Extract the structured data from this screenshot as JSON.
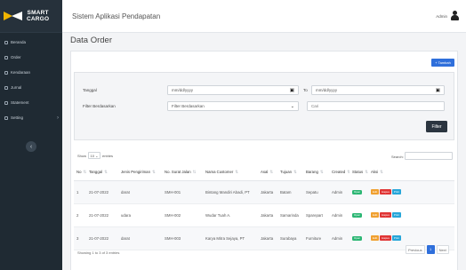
{
  "brand": {
    "line1": "SMART",
    "line2": "CARGO"
  },
  "app_title": "Sistem Aplikasi Pendapatan",
  "user": {
    "name": "Admin"
  },
  "sidebar": {
    "items": [
      {
        "label": "Beranda"
      },
      {
        "label": "Order"
      },
      {
        "label": "Kendaraan"
      },
      {
        "label": "Jurnal"
      },
      {
        "label": "Statement"
      },
      {
        "label": "Setting"
      }
    ],
    "toggle_icon": "‹"
  },
  "page_title": "Data Order",
  "buttons": {
    "tambah": "+ Tambah",
    "filter": "Filter"
  },
  "filter": {
    "tanggal_label": "Tanggal",
    "date_from": "mm/dd/yyyy",
    "to_label": "To",
    "date_to": "mm/dd/yyyy",
    "berdasarkan_label": "Filter Berdasarkan",
    "select_value": "Filter Berdasarkan",
    "cari_placeholder": "Cari"
  },
  "table_controls": {
    "show_label": "Show",
    "entries_value": "10",
    "entries_label": "entries",
    "search_label": "Search:"
  },
  "table": {
    "headers": [
      "No",
      "Tanggal",
      "Jenis Pengiriman",
      "No. Surat Jalan",
      "Nama Customer",
      "Asal",
      "Tujuan",
      "Barang",
      "Created",
      "Status",
      "Aksi"
    ],
    "rows": [
      [
        "1",
        "21-07-2022",
        "darat",
        "SMH-001",
        "Bintang Mandiri Abadi, PT",
        "Jakarta",
        "Batam",
        "Sepatu",
        "Admin",
        "Open"
      ],
      [
        "2",
        "21-07-2022",
        "udara",
        "SMH-002",
        "Wudar Tuah A.",
        "Jakarta",
        "Samarinda",
        "Sparepart",
        "Admin",
        "Open"
      ],
      [
        "3",
        "21-07-2022",
        "darat",
        "SMH-003",
        "Karya Mitra Sejaya, PT",
        "Jakarta",
        "Surabaya",
        "Furniture",
        "Admin",
        "Open"
      ]
    ],
    "actions": {
      "edit": "Edit",
      "delete": "Hapus",
      "print": "Print"
    }
  },
  "info_text": "Showing 1 to 3 of 3 entries",
  "pagination": {
    "previous": "Previous",
    "current": "1",
    "next": "Next"
  },
  "colors": {
    "sidebar": "#1f2a33",
    "primary": "#2f6fdb",
    "success": "#2bb673",
    "warning": "#f0a030",
    "danger": "#e03535",
    "info": "#27a6d9"
  }
}
